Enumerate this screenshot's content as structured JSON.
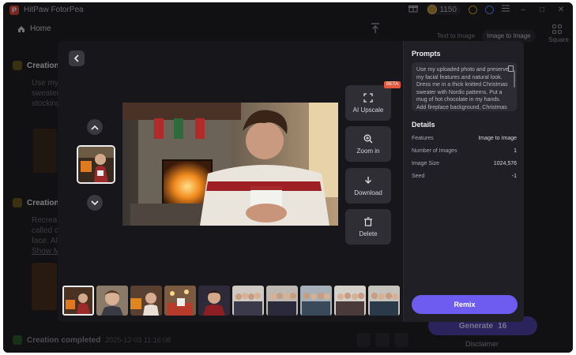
{
  "app": {
    "title": "HitPaw FotorPea",
    "coins": "1150",
    "window_controls": {
      "minimize": "–",
      "maximize": "□",
      "close": "✕"
    }
  },
  "background": {
    "home_label": "Home",
    "tabs": [
      "Text to Image",
      "Image to Image"
    ],
    "square_label": "Square",
    "creation_1_title": "Creation",
    "creation_1_text": [
      "Use my",
      "sweater",
      "stocking"
    ],
    "creation_2_title": "Creation",
    "creation_2_text": [
      "Recreat",
      "called d",
      "face. Al",
      "Show M"
    ],
    "completed_label": "Creation completed",
    "completed_time": "2025-12-03 11:16:08",
    "generate_label": "Generate",
    "generate_cost": "16",
    "disclaimer_label": "Disclaimer"
  },
  "viewer": {
    "tools": {
      "upscale_label": "AI Upscale",
      "beta_badge": "BETA",
      "zoom_label": "Zoom in",
      "download_label": "Download",
      "delete_label": "Delete"
    },
    "thumbnail_count": 10
  },
  "panel": {
    "prompts_heading": "Prompts",
    "prompt_text": "Use my uploaded photo and preserve my facial features and natural look. Dress me in a thick knitted Christmas sweater with Nordic patterns. Put a mug of hot chocolate in my hands. Add fireplace background, Christmas",
    "details_heading": "Details",
    "details": [
      {
        "key": "Features",
        "value": "Image to Image"
      },
      {
        "key": "Number of Images",
        "value": "1"
      },
      {
        "key": "Image Size",
        "value": "1024,576"
      },
      {
        "key": "Seed",
        "value": "-1"
      }
    ],
    "remix_label": "Remix"
  },
  "colors": {
    "accent": "#6e5cf0",
    "beta": "#e2583f",
    "panel_bg": "#201f25",
    "modal_bg": "#17161b"
  }
}
